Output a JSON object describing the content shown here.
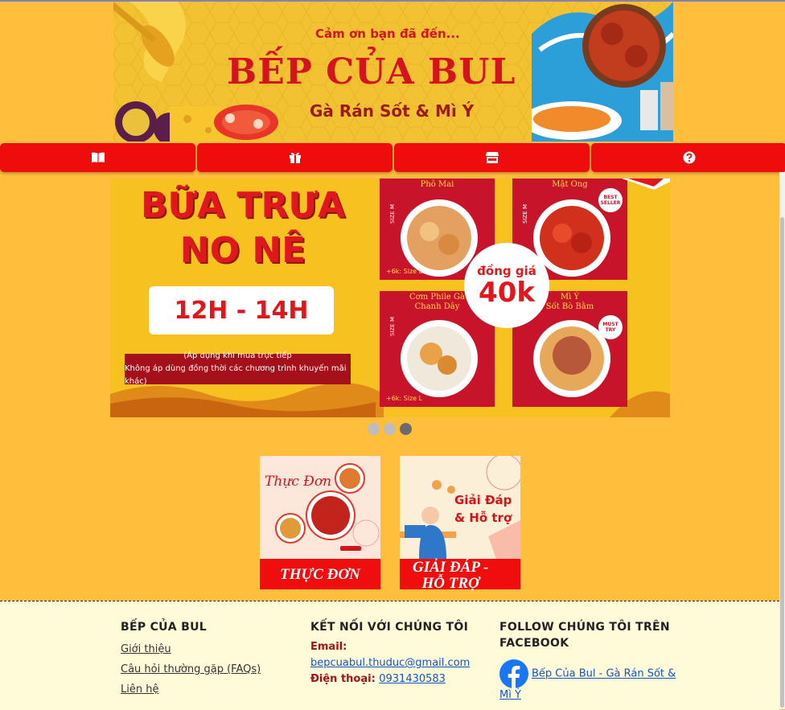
{
  "banner": {
    "thanks": "Cảm ơn bạn đã đến...",
    "title": "BẾP CỦA BUL",
    "subtitle": "Gà Rán Sốt & Mì Ý"
  },
  "nav": {
    "items": [
      {
        "icon": "book-icon"
      },
      {
        "icon": "gift-icon"
      },
      {
        "icon": "store-icon"
      },
      {
        "icon": "question-circle-icon"
      }
    ]
  },
  "promo": {
    "title": "BỮA TRƯA\nNO NÊ",
    "time": "12H - 14H",
    "note_line1": "(Áp dụng khi mua trực tiếp",
    "note_line2": "Không áp dùng đồng thời các chương trình khuyến mãi khác)",
    "price_label": "đồng giá",
    "price_value": "40k",
    "cards": [
      {
        "name": "Phô Mai",
        "side": "SIZE M",
        "size": "+6k: Size L"
      },
      {
        "name": "Mật Ong",
        "side": "SIZE M",
        "badge": "BEST SELLER"
      },
      {
        "name": "Cơm Phile Gà\nChanh Dây",
        "side": "SIZE M",
        "size": "+6k: Size L"
      },
      {
        "name": "Mì Ý\nSốt Bò Bằm",
        "badge": "MUST TRY"
      }
    ],
    "slides_total": 3,
    "slide_active": 3
  },
  "tiles": [
    {
      "image_title": "Thực Đơn",
      "label": "THỰC ĐƠN"
    },
    {
      "image_title": "Giải Đáp\n& Hỗ trợ",
      "label_line1": "GIẢI ĐÁP -",
      "label_line2": "HỖ TRỢ"
    }
  ],
  "footer": {
    "col1": {
      "heading": "BẾP CỦA BUL",
      "links": [
        "Giới thiệu",
        "Câu hỏi thường gặp (FAQs)",
        "Liên hệ"
      ]
    },
    "col2": {
      "heading": "KẾT NỐI VỚI CHÚNG TÔI",
      "email_label": "Email:",
      "email": "bepcuabul.thuduc@gmail.com",
      "phone_label": "Điện thoại:",
      "phone": "0931430583"
    },
    "col3": {
      "heading": "FOLLOW CHÚNG TÔI TRÊN FACEBOOK",
      "fb_link": "Bếp Của Bul - Gà Rán Sốt & Mì Ý"
    }
  },
  "colors": {
    "page_bg": "#FFBE3C",
    "nav_red": "#EE0C0C",
    "brand_red": "#D4131C",
    "footer_bg": "#FFFAD8"
  }
}
